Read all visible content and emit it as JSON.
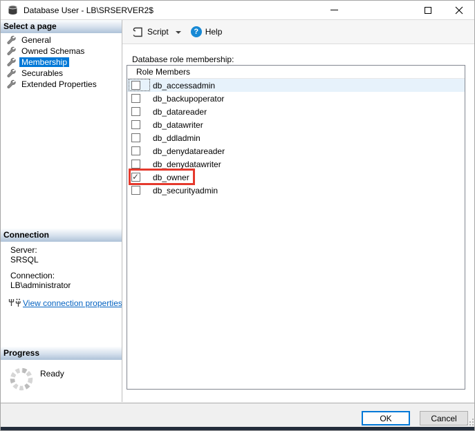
{
  "window": {
    "title": "Database User - LB\\SRSERVER2$"
  },
  "titlebar": {
    "icons": [
      "database-icon",
      "minimize",
      "maximize",
      "close"
    ]
  },
  "toolbar": {
    "script_label": "Script",
    "help_label": "Help",
    "help_glyph": "?"
  },
  "sidebar": {
    "header": "Select a page",
    "items": [
      {
        "label": "General",
        "selected": false
      },
      {
        "label": "Owned Schemas",
        "selected": false
      },
      {
        "label": "Membership",
        "selected": true
      },
      {
        "label": "Securables",
        "selected": false
      },
      {
        "label": "Extended Properties",
        "selected": false
      }
    ]
  },
  "main": {
    "field_label": "Database role membership:",
    "list_header": "Role Members",
    "roles": [
      {
        "name": "db_accessadmin",
        "checked": false,
        "focused": true,
        "highlighted": true
      },
      {
        "name": "db_backupoperator",
        "checked": false
      },
      {
        "name": "db_datareader",
        "checked": false
      },
      {
        "name": "db_datawriter",
        "checked": false
      },
      {
        "name": "db_ddladmin",
        "checked": false
      },
      {
        "name": "db_denydatareader",
        "checked": false
      },
      {
        "name": "db_denydatawriter",
        "checked": false
      },
      {
        "name": "db_owner",
        "checked": true,
        "annotated": true
      },
      {
        "name": "db_securityadmin",
        "checked": false
      }
    ]
  },
  "connection": {
    "header": "Connection",
    "server_label": "Server:",
    "server_value": "SRSQL",
    "connection_label": "Connection:",
    "connection_value": "LB\\administrator",
    "link_label": "View connection properties"
  },
  "progress": {
    "header": "Progress",
    "status": "Ready"
  },
  "footer": {
    "ok_label": "OK",
    "cancel_label": "Cancel"
  },
  "colors": {
    "accent_blue": "#0078d7",
    "annotation_red": "#e5392c",
    "selected_row_blue": "#e7f2fb",
    "header_gradient_bottom": "#aec2d8",
    "link_blue": "#0563c1",
    "help_icon_blue": "#1789d5",
    "bottom_strip": "#232d3b"
  }
}
